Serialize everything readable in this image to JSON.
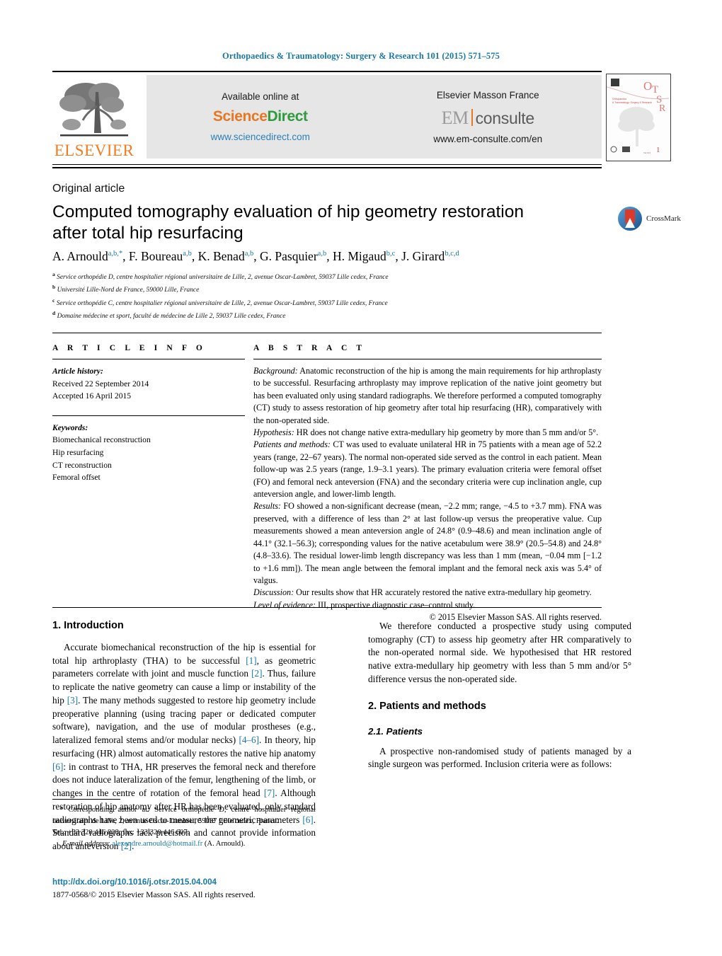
{
  "running_head": "Orthopaedics & Traumatology: Surgery & Research 101 (2015) 571–575",
  "banner": {
    "publisher_logo_text": "ELSEVIER",
    "available_online_label": "Available online at",
    "sciencedirect_part1": "Science",
    "sciencedirect_part2": "Direct",
    "sciencedirect_url": "www.sciencedirect.com",
    "masson_label": "Elsevier Masson France",
    "em_part1": "EM",
    "em_part2": "consulte",
    "em_url": "www.em-consulte.com/en",
    "cover_thumb_alt": "journal-cover-thumbnail"
  },
  "article": {
    "type": "Original article",
    "title": "Computed tomography evaluation of hip geometry restoration after total hip resurfacing",
    "crossmark_label": "CrossMark",
    "authors_html": "A. Arnould<sup>a,b,*</sup>, F. Boureau<sup>a,b</sup>, K. Benad<sup>a,b</sup>, G. Pasquier<sup>a,b</sup>, H. Migaud<sup>b,c</sup>, J. Girard<sup>b,c,d</sup>",
    "affiliations": [
      {
        "marker": "a",
        "text": "Service orthopédie D, centre hospitalier régional universitaire de Lille, 2, avenue Oscar-Lambret, 59037 Lille cedex, France"
      },
      {
        "marker": "b",
        "text": "Université Lille-Nord de France, 59000 Lille, France"
      },
      {
        "marker": "c",
        "text": "Service orthopédie C, centre hospitalier régional universitaire de Lille, 2, avenue Oscar-Lambret, 59037 Lille cedex, France"
      },
      {
        "marker": "d",
        "text": "Domaine médecine et sport, faculté de médecine de Lille 2, 59037 Lille cedex, France"
      }
    ]
  },
  "info": {
    "heading": "A R T I C L E   I N F O",
    "history_label": "Article history:",
    "received": "Received 22 September 2014",
    "accepted": "Accepted 16 April 2015",
    "keywords_label": "Keywords:",
    "keywords": [
      "Biomechanical reconstruction",
      "Hip resurfacing",
      "CT reconstruction",
      "Femoral offset"
    ]
  },
  "abstract": {
    "heading": "A B S T R A C T",
    "background_label": "Background:",
    "background_text": " Anatomic reconstruction of the hip is among the main requirements for hip arthroplasty to be successful. Resurfacing arthroplasty may improve replication of the native joint geometry but has been evaluated only using standard radiographs. We therefore performed a computed tomography (CT) study to assess restoration of hip geometry after total hip resurfacing (HR), comparatively with the non-operated side.",
    "hypothesis_label": "Hypothesis:",
    "hypothesis_text": " HR does not change native extra-medullary hip geometry by more than 5 mm and/or 5°.",
    "patients_label": "Patients and methods:",
    "patients_text": " CT was used to evaluate unilateral HR in 75 patients with a mean age of 52.2 years (range, 22–67 years). The normal non-operated side served as the control in each patient. Mean follow-up was 2.5 years (range, 1.9–3.1 years). The primary evaluation criteria were femoral offset (FO) and femoral neck anteversion (FNA) and the secondary criteria were cup inclination angle, cup anteversion angle, and lower-limb length.",
    "results_label": "Results:",
    "results_text": " FO showed a non-significant decrease (mean, −2.2 mm; range, −4.5 to +3.7 mm). FNA was preserved, with a difference of less than 2° at last follow-up versus the preoperative value. Cup measurements showed a mean anteversion angle of 24.8° (0.9–48.6) and mean inclination angle of 44.1° (32.1–56.3); corresponding values for the native acetabulum were 38.9° (20.5–54.8) and 24.8° (4.8–33.6). The residual lower-limb length discrepancy was less than 1 mm (mean, −0.04 mm [−1.2 to +1.6 mm]). The mean angle between the femoral implant and the femoral neck axis was 5.4° of valgus.",
    "discussion_label": "Discussion:",
    "discussion_text": " Our results show that HR accurately restored the native extra-medullary hip geometry.",
    "evidence_label": "Level of evidence:",
    "evidence_text": " III, prospective diagnostic case–control study.",
    "copyright": "© 2015 Elsevier Masson SAS. All rights reserved."
  },
  "body": {
    "intro_heading": "1. Introduction",
    "intro_p1_a": "Accurate biomechanical reconstruction of the hip is essential for total hip arthroplasty (THA) to be successful ",
    "intro_p1_r1": "[1]",
    "intro_p1_b": ", as geometric parameters correlate with joint and muscle function ",
    "intro_p1_r2": "[2]",
    "intro_p1_c": ". Thus, failure to replicate the native geometry can cause a limp or instability of the hip ",
    "intro_p1_r3": "[3]",
    "intro_p1_d": ". The many methods suggested to restore hip geometry include preoperative planning (using tracing paper or dedicated computer software), navigation, and the use of modular prostheses (e.g., lateralized femoral stems and/or modular necks) ",
    "intro_p1_r4": "[4–6]",
    "intro_p1_e": ". In theory, hip resurfacing (HR) almost automatically restores the native hip anatomy ",
    "intro_p1_r5": "[6]",
    "intro_p1_f": ": in contrast to THA, HR preserves the femoral neck and therefore does not induce lateralization of the femur, lengthening of the limb, or changes in the centre of rotation of the femoral head ",
    "intro_p1_r6": "[7]",
    "intro_p1_g": ". Although restoration of hip anatomy after HR has been evaluated, only standard radiographs have been used to measure the geometric parameters ",
    "intro_p1_r7": "[6]",
    "intro_p1_h": ". Standard radiographs lack precision and cannot provide information about anteversion ",
    "intro_p1_r8": "[2]",
    "intro_p1_i": ".",
    "intro_p2": "We therefore conducted a prospective study using computed tomography (CT) to assess hip geometry after HR comparatively to the non-operated normal side. We hypothesised that HR restored native extra-medullary hip geometry with less than 5 mm and/or 5° difference versus the non-operated side.",
    "methods_heading": "2. Patients and methods",
    "patients_subheading": "2.1. Patients",
    "patients_p1": "A prospective non-randomised study of patients managed by a single surgeon was performed. Inclusion criteria were as follows:"
  },
  "footnote": {
    "star_text": "* Corresponding author at: Service orthopédie D, centre hospitalier régional universitaire de Lille, 2, avenue Oscar-Lambret, 59037 Lille cedex, France.",
    "tel_text": "Tel.: +33 320 446 828; fax: +33 320 446 607.",
    "email_label": "E-mail address:",
    "email_value": "alexandre.arnould@hotmail.fr",
    "email_suffix": " (A. Arnould).",
    "doi": "http://dx.doi.org/10.1016/j.otsr.2015.04.004",
    "issn": "1877-0568/© 2015 Elsevier Masson SAS. All rights reserved."
  },
  "colors": {
    "link_blue": "#1878a8",
    "elsevier_orange": "#ef7d22",
    "sciencedirect_green": "#2e9b3f",
    "banner_grey": "#e6e6e6"
  }
}
